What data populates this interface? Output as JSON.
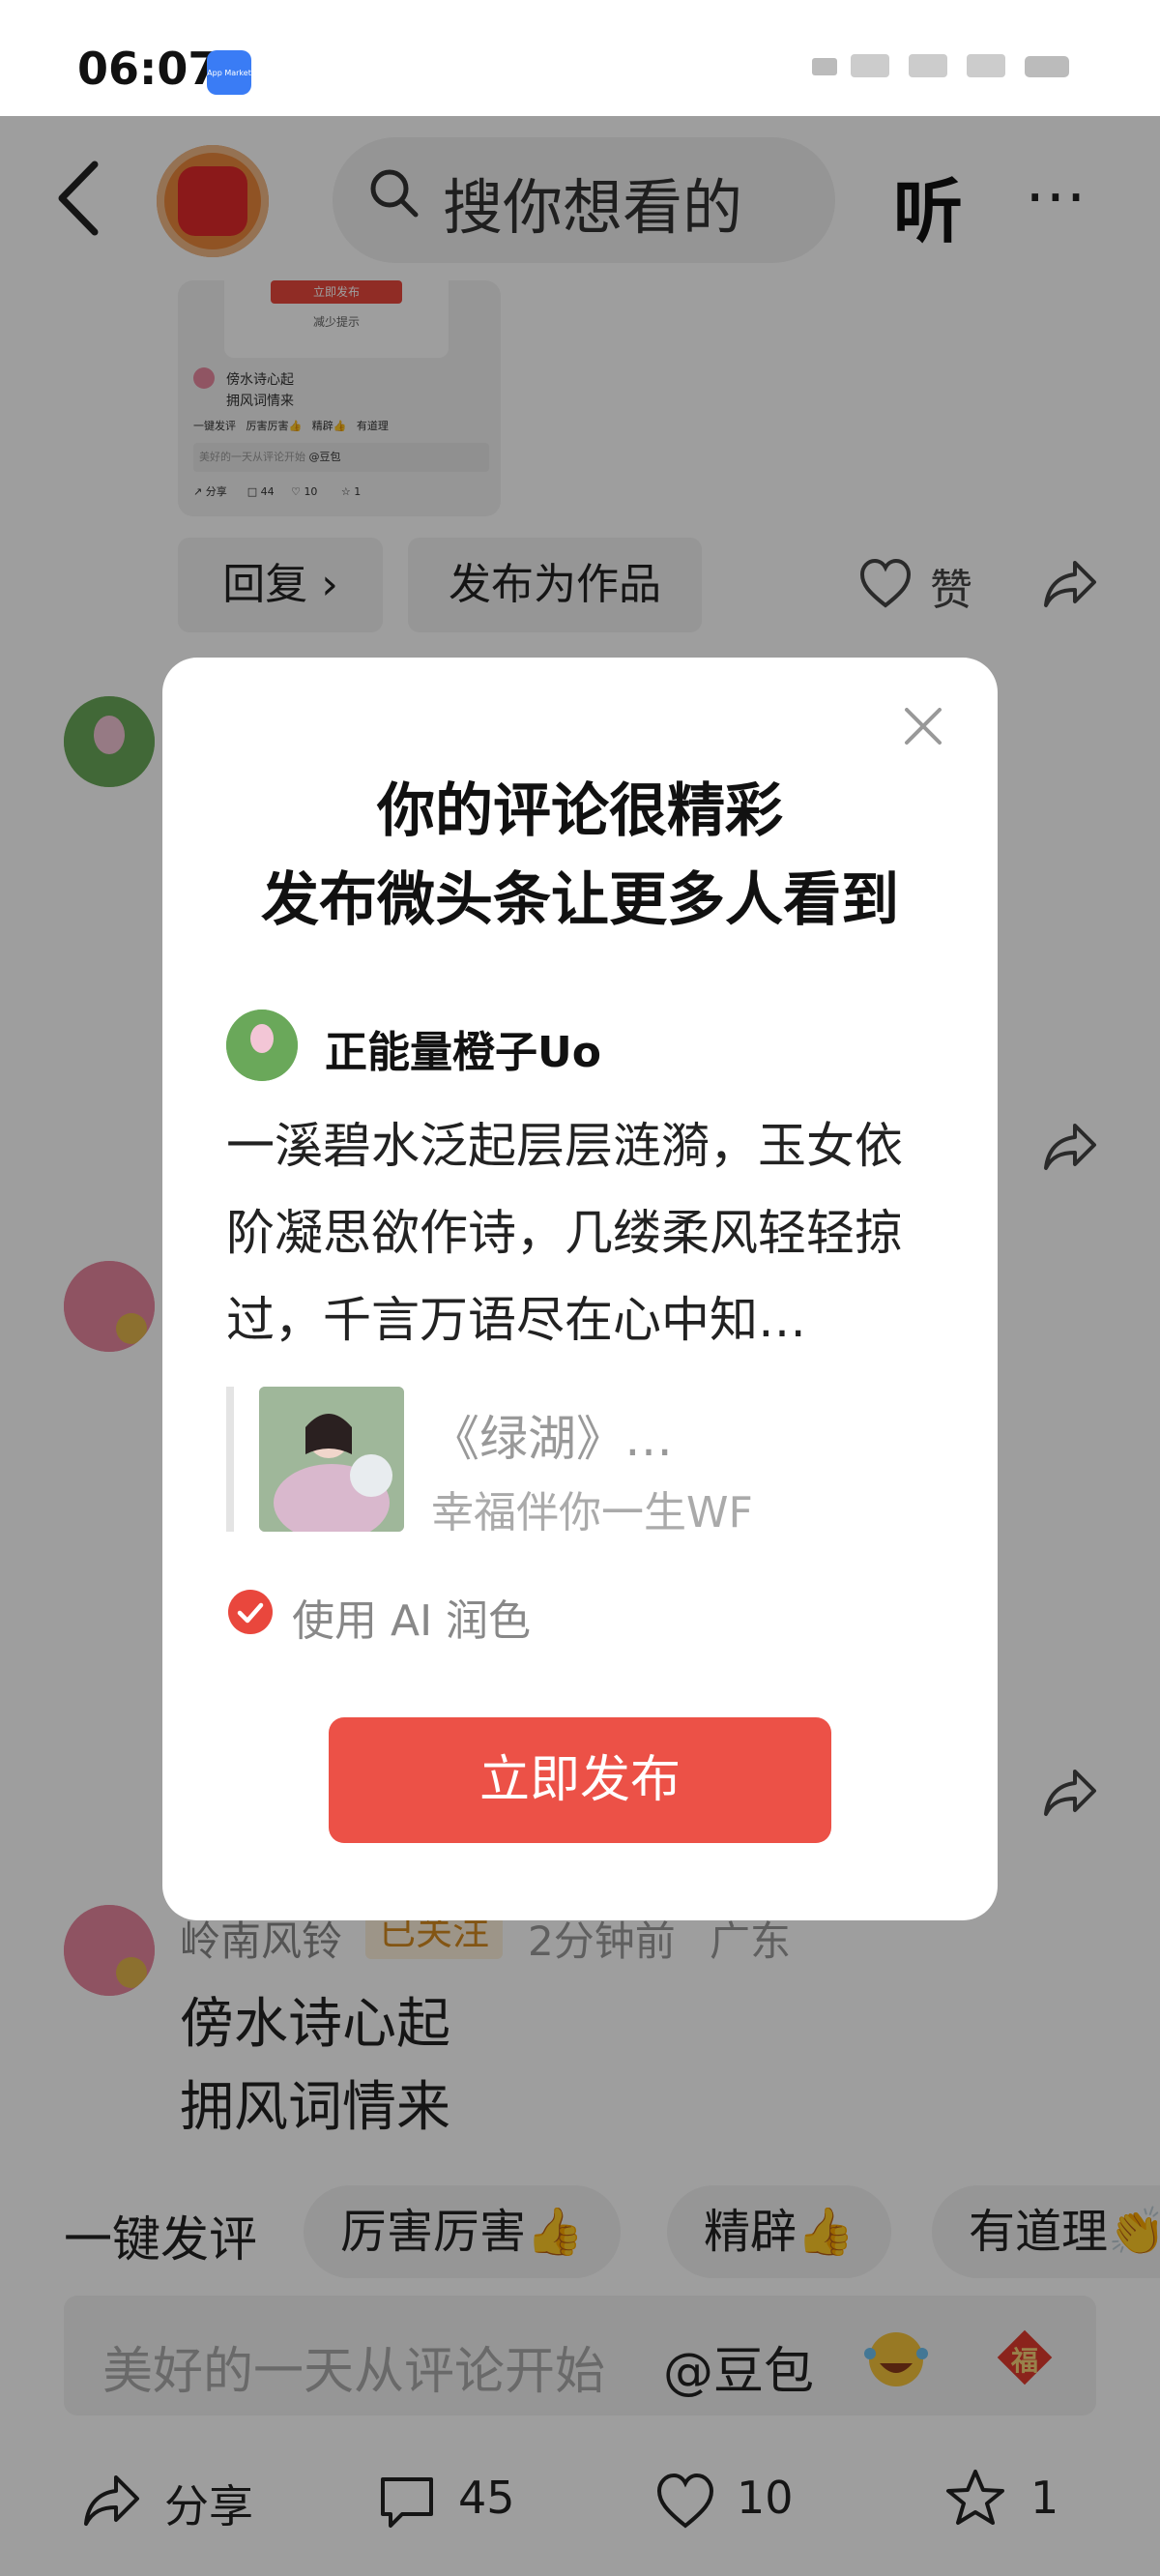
{
  "status_bar": {
    "time": "06:07",
    "app_badge": "App Market"
  },
  "top_bar": {
    "search_placeholder": "搜你想看的",
    "listen_label": "听",
    "more_label": "⋯",
    "back_icon": "chevron-left-icon"
  },
  "comment_actions": {
    "reply": "回复 ›",
    "publish_as_work": "发布为作品",
    "like": "赞"
  },
  "thumbnail": {
    "button": "立即发布",
    "reduce": "减少提示",
    "line1": "傍水诗心起",
    "line2": "拥风词情来",
    "chips": [
      "一键发评",
      "厉害厉害👍",
      "精辟👍",
      "有道理"
    ],
    "input": "美好的一天从评论开始",
    "mention": "@豆包",
    "share": "分享",
    "comments": "44",
    "likes": "10",
    "stars": "1"
  },
  "comment3": {
    "name": "岭南风铃",
    "follow": "已关注",
    "time": "2分钟前",
    "region": "广东",
    "line1": "傍水诗心起",
    "line2": "拥风词情来"
  },
  "quick_reply": {
    "label": "一键发评",
    "chips": [
      "厉害厉害👍",
      "精辟👍",
      "有道理👏"
    ]
  },
  "input_bar": {
    "placeholder": "美好的一天从评论开始",
    "mention": "@豆包",
    "fu": "福"
  },
  "bottom_bar": {
    "share": "分享",
    "comments": "45",
    "likes": "10",
    "stars": "1"
  },
  "modal": {
    "title_line1": "你的评论很精彩",
    "title_line2": "发布微头条让更多人看到",
    "author": "正能量橙子Uo",
    "body": "一溪碧水泛起层层涟漪，玉女依阶凝思欲作诗，几缕柔风轻轻掠过，千言万语尽在心中知…",
    "quote_title": "《绿湖》…",
    "quote_author": "幸福伴你一生WF",
    "ai_polish_label": "使用 AI 润色",
    "ai_polish_checked": true,
    "publish_button": "立即发布"
  },
  "colors": {
    "accent": "#ec5147",
    "follow_badge_bg": "#fdf0dc",
    "follow_badge_text": "#d48a20"
  }
}
